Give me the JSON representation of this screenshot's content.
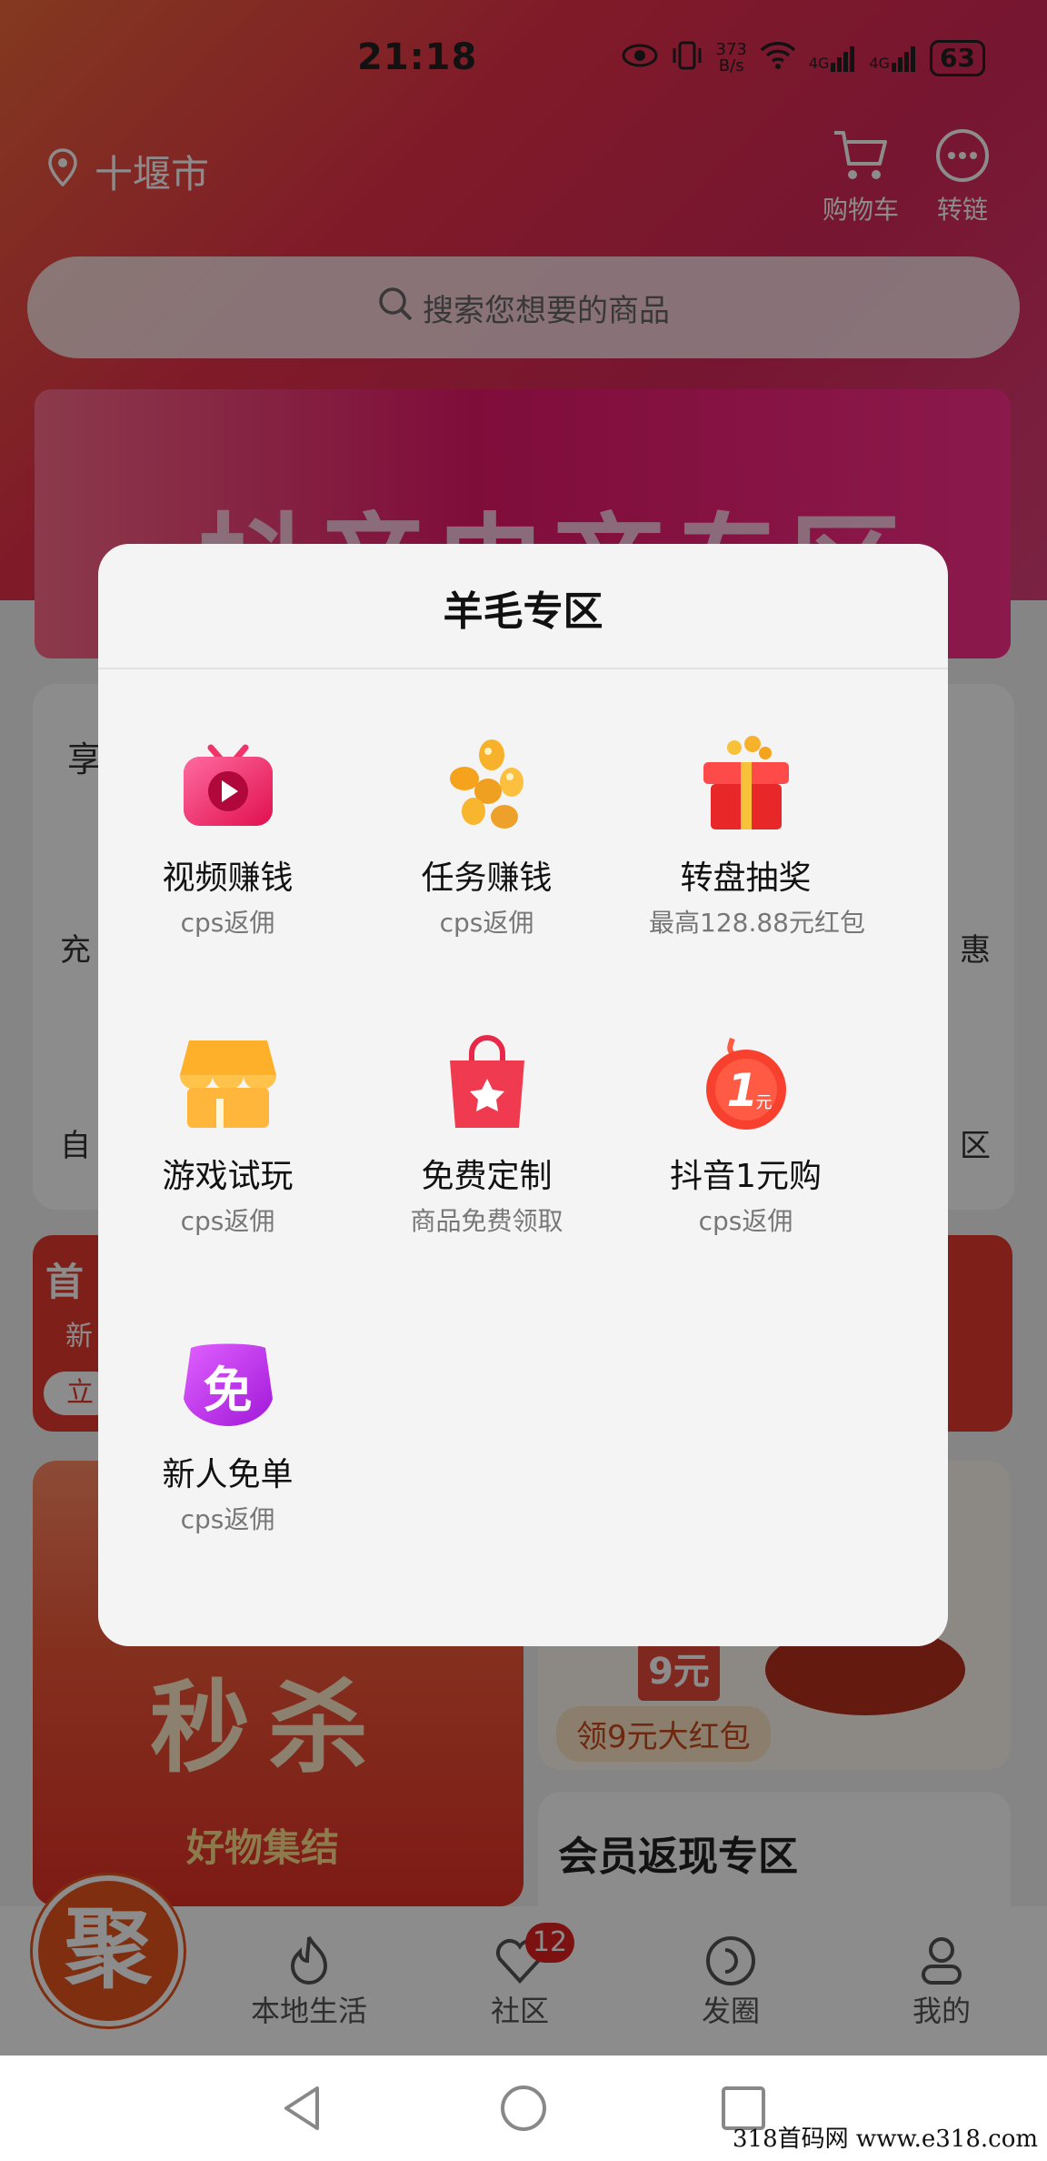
{
  "status_bar": {
    "time": "21:18",
    "net_speed_top": "373",
    "net_speed_bottom": "B/s",
    "signal1": "4G",
    "signal2": "4G",
    "battery": "63"
  },
  "header": {
    "city": "十堰市",
    "cart_label": "购物车",
    "share_label": "转链",
    "search_placeholder": "搜索您想要的商品"
  },
  "banner": {
    "text": "抖音电商专区"
  },
  "background": {
    "left_frag1": "享",
    "left_frag2": "充",
    "left_frag3": "自",
    "right_frag1": "惠",
    "right_frag2": "区",
    "red_frag_left": "首",
    "red_frag_left2": "新",
    "red_frag_left3": "立",
    "sale_text": "秒杀",
    "sale_sub": "好物集结",
    "red_packet_price": "9元",
    "red_packet_label": "领9元大红包",
    "vip_title": "会员返现专区"
  },
  "modal": {
    "title": "羊毛专区",
    "items": [
      {
        "name": "视频赚钱",
        "sub": "cps返佣",
        "icon": "tv-play-icon"
      },
      {
        "name": "任务赚钱",
        "sub": "cps返佣",
        "icon": "gold-coins-icon"
      },
      {
        "name": "转盘抽奖",
        "sub": "最高128.88元红包",
        "icon": "gift-box-icon"
      },
      {
        "name": "游戏试玩",
        "sub": "cps返佣",
        "icon": "shop-icon"
      },
      {
        "name": "免费定制",
        "sub": "商品免费领取",
        "icon": "shopping-bag-icon"
      },
      {
        "name": "抖音1元购",
        "sub": "cps返佣",
        "icon": "one-yuan-icon",
        "badge_num": "1",
        "badge_unit": "元"
      },
      {
        "name": "新人免单",
        "sub": "cps返佣",
        "icon": "free-badge-icon",
        "badge_text": "免"
      }
    ]
  },
  "bottom_nav": {
    "logo_text": "聚",
    "items": [
      "本地生活",
      "社区",
      "发圈",
      "我的"
    ],
    "community_badge": "12"
  },
  "watermark": "318首码网  www.e318.com",
  "colors": {
    "accent": "#e8314a",
    "modal_bg": "#f5f4f4"
  }
}
